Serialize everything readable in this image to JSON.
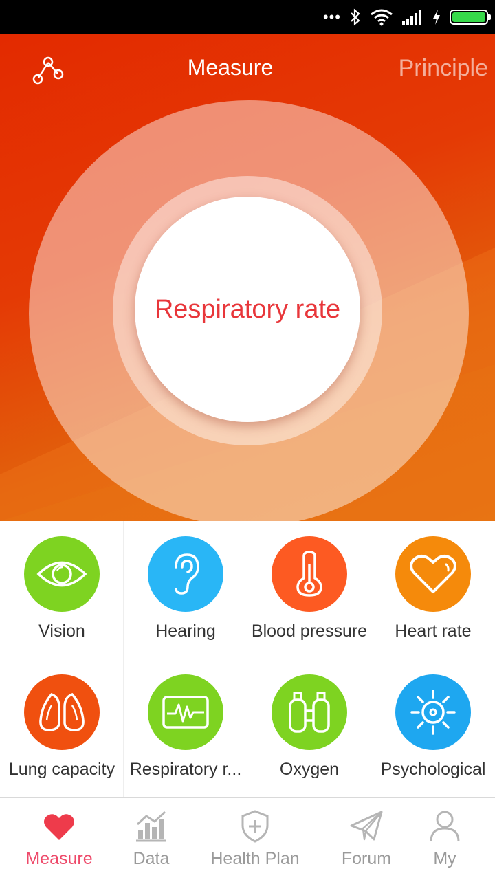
{
  "header": {
    "title": "Measure",
    "right_tab": "Principle"
  },
  "center_button": {
    "label": "Respiratory rate"
  },
  "tests": [
    {
      "label": "Vision",
      "icon": "eye-icon",
      "color": "#7ed321"
    },
    {
      "label": "Hearing",
      "icon": "ear-icon",
      "color": "#29b6f6"
    },
    {
      "label": "Blood pressure",
      "icon": "thermometer-icon",
      "color": "#fd5a22"
    },
    {
      "label": "Heart rate",
      "icon": "heart-icon",
      "color": "#f58a0b"
    },
    {
      "label": "Lung capacity",
      "icon": "lungs-icon",
      "color": "#f0500f"
    },
    {
      "label": "Respiratory r...",
      "icon": "waveform-icon",
      "color": "#7ed321"
    },
    {
      "label": "Oxygen",
      "icon": "oxygen-tank-icon",
      "color": "#7ed321"
    },
    {
      "label": "Psychological",
      "icon": "sun-icon",
      "color": "#1ea7f0"
    }
  ],
  "bottom_nav": [
    {
      "label": "Measure",
      "icon": "heart-icon",
      "active": true
    },
    {
      "label": "Data",
      "icon": "chart-icon",
      "active": false
    },
    {
      "label": "Health Plan",
      "icon": "shield-plus-icon",
      "active": false
    },
    {
      "label": "Forum",
      "icon": "paper-plane-icon",
      "active": false
    },
    {
      "label": "My",
      "icon": "person-icon",
      "active": false
    }
  ],
  "colors": {
    "accent": "#e8363a",
    "nav_active": "#ee4a6a",
    "hero_top": "#e32a00",
    "hero_bottom": "#e3700f"
  }
}
